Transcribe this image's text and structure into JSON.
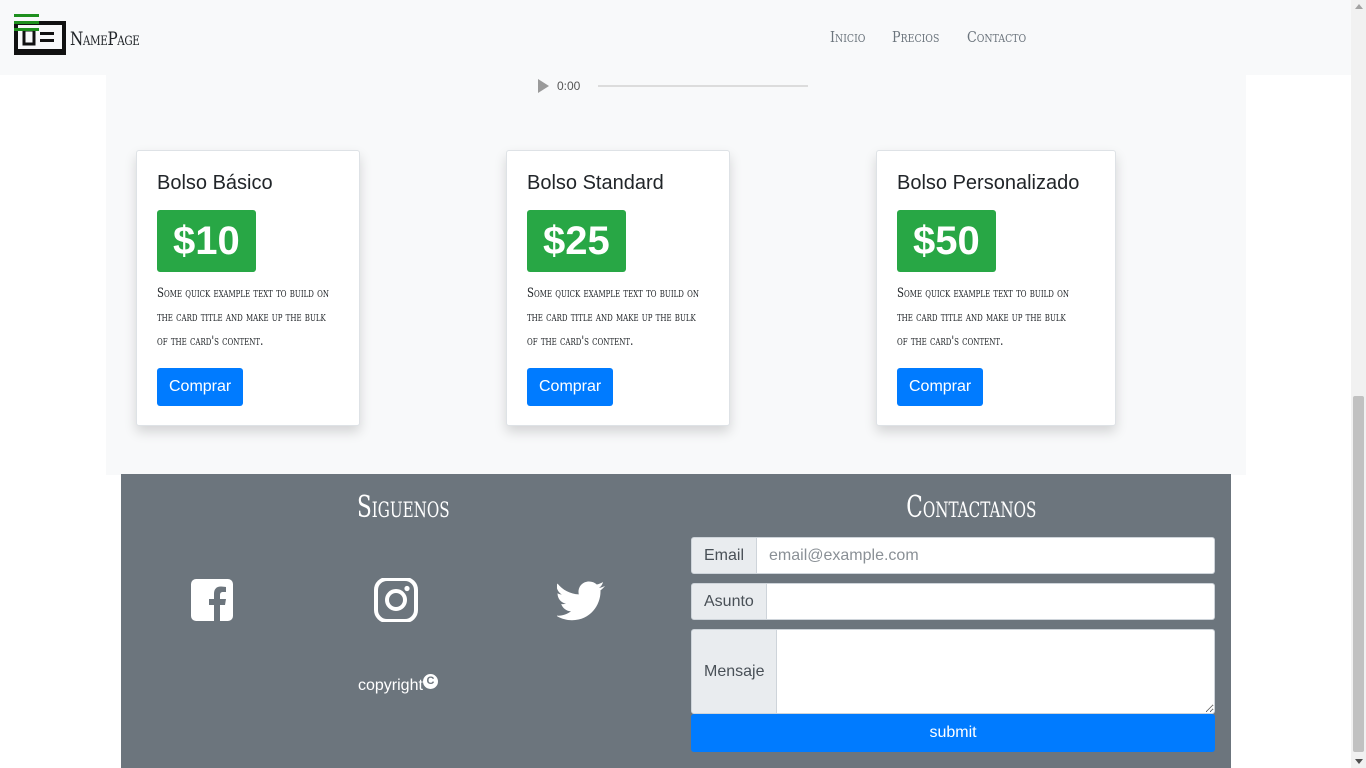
{
  "navbar": {
    "brand": "NamePage",
    "links": [
      "Inicio",
      "Precios",
      "Contacto"
    ]
  },
  "audio": {
    "time": "0:00"
  },
  "cards": [
    {
      "title": "Bolso Básico",
      "price": "$10",
      "text": "Some quick example text to build on the card title and make up the bulk of the card's content.",
      "button": "Comprar"
    },
    {
      "title": "Bolso Standard",
      "price": "$25",
      "text": "Some quick example text to build on the card title and make up the bulk of the card's content.",
      "button": "Comprar"
    },
    {
      "title": "Bolso Personalizado",
      "price": "$50",
      "text": "Some quick example text to build on the card title and make up the bulk of the card's content.",
      "button": "Comprar"
    }
  ],
  "footer": {
    "follow_heading": "Siguenos",
    "contact_heading": "Contactanos",
    "social_icons": [
      "facebook-icon",
      "instagram-icon",
      "twitter-icon"
    ],
    "copyright": "copyright",
    "form": {
      "email_label": "Email",
      "email_placeholder": "email@example.com",
      "subject_label": "Asunto",
      "message_label": "Mensaje",
      "submit_label": "submit"
    }
  },
  "colors": {
    "navbar_bg": "#f8f9fa",
    "price_badge": "#28a745",
    "primary_button": "#007bff",
    "footer_bg": "#6c757d",
    "brand_icon_accent": "#1e8f1e"
  }
}
